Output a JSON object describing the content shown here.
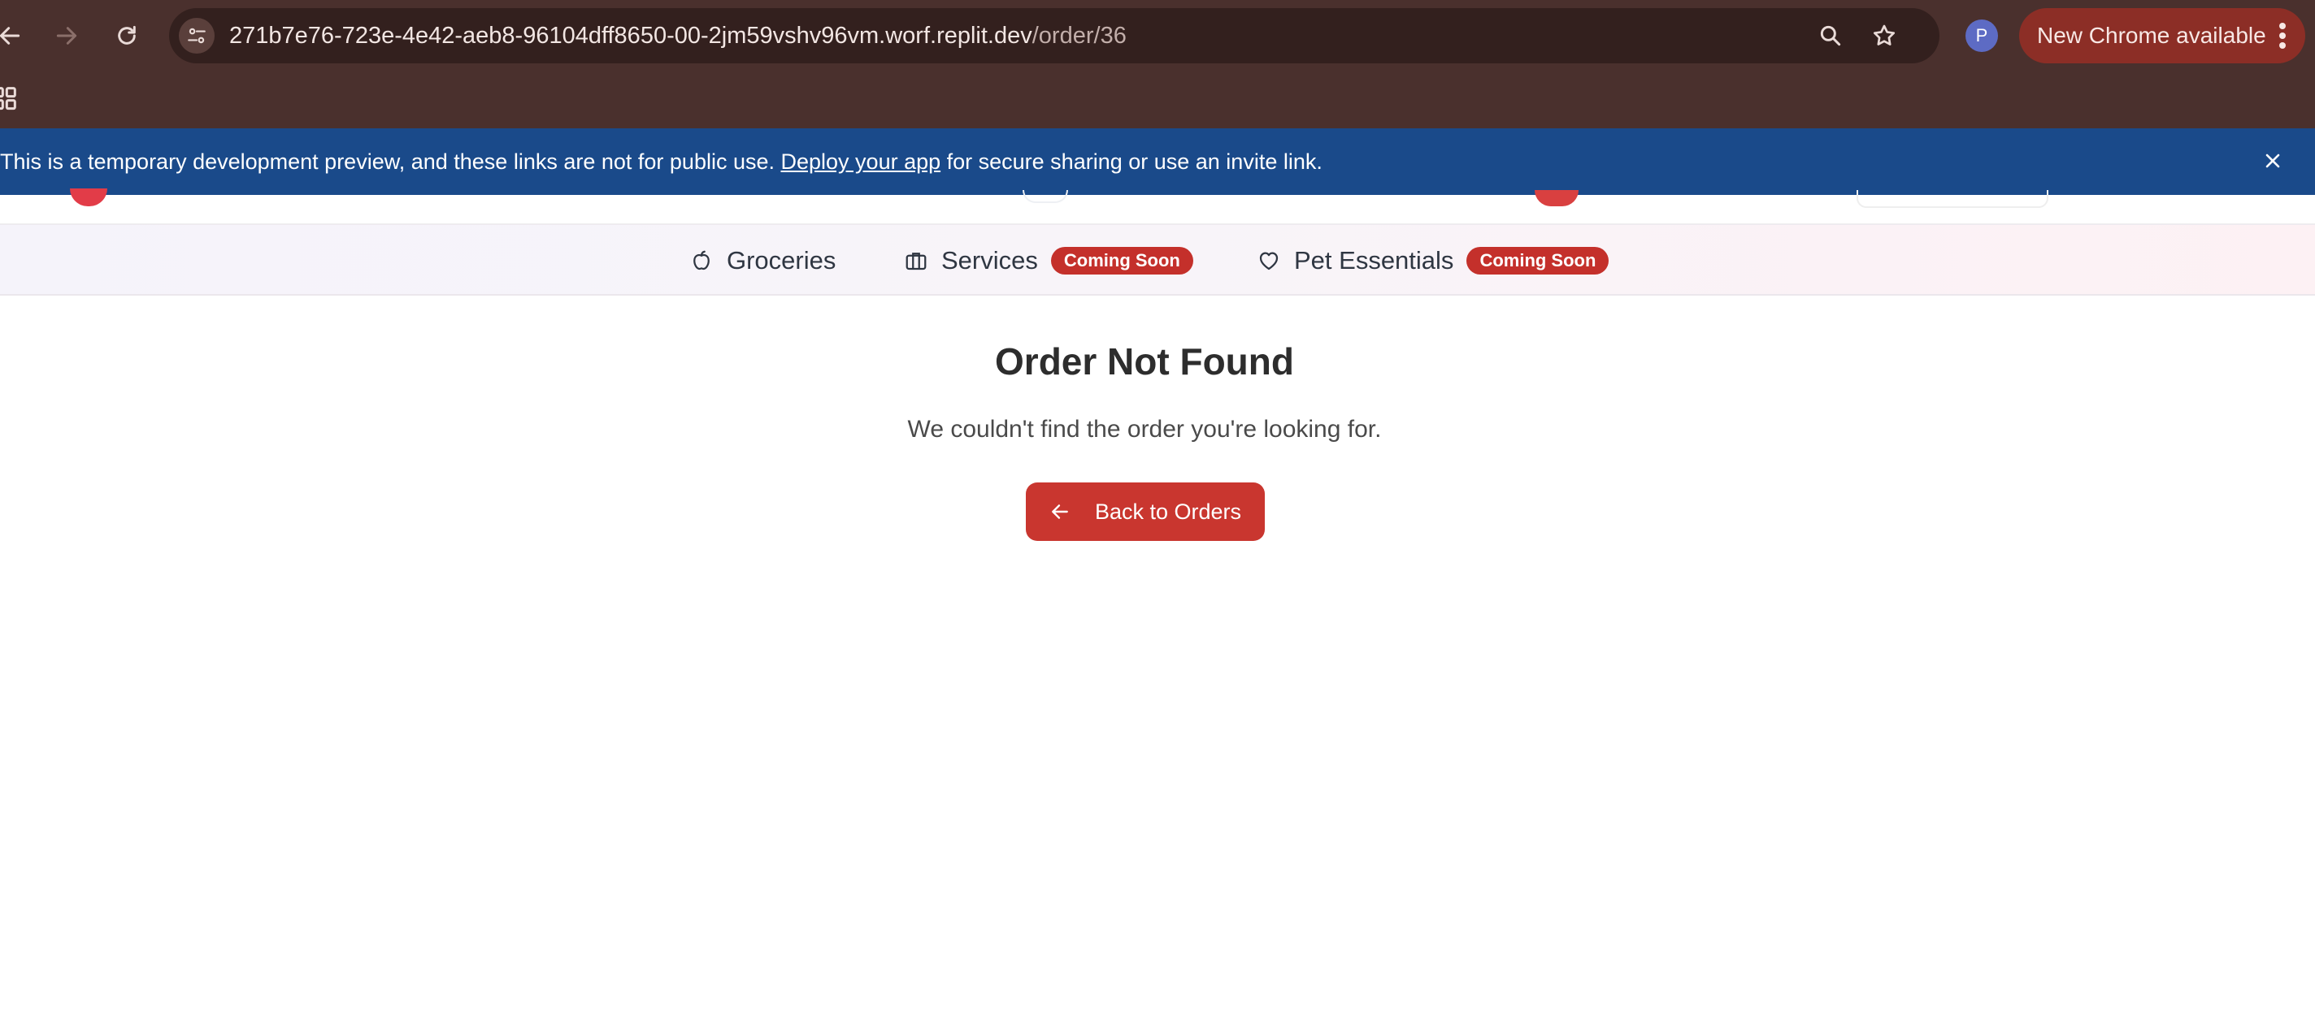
{
  "browser": {
    "url_host": "271b7e76-723e-4e42-aeb8-96104dff8650-00-2jm59vshv96vm.worf.replit.dev",
    "url_path": "/order/36",
    "profile_initial": "P",
    "update_label": "New Chrome available"
  },
  "dev_banner": {
    "text_before": "This is a temporary development preview, and these links are not for public use. ",
    "link": "Deploy your app",
    "text_after": " for secure sharing or use an invite link."
  },
  "categories": [
    {
      "label": "Groceries",
      "icon": "basket-icon"
    },
    {
      "label": "Services",
      "icon": "briefcase-icon",
      "badge": "Coming Soon"
    },
    {
      "label": "Pet Essentials",
      "icon": "heart-icon",
      "badge": "Coming Soon"
    }
  ],
  "main": {
    "title": "Order Not Found",
    "message": "We couldn't find the order you're looking for.",
    "back_button": "Back to Orders"
  },
  "colors": {
    "chrome": "#4a302d",
    "banner": "#1a4a8a",
    "accent": "#c9362f"
  }
}
